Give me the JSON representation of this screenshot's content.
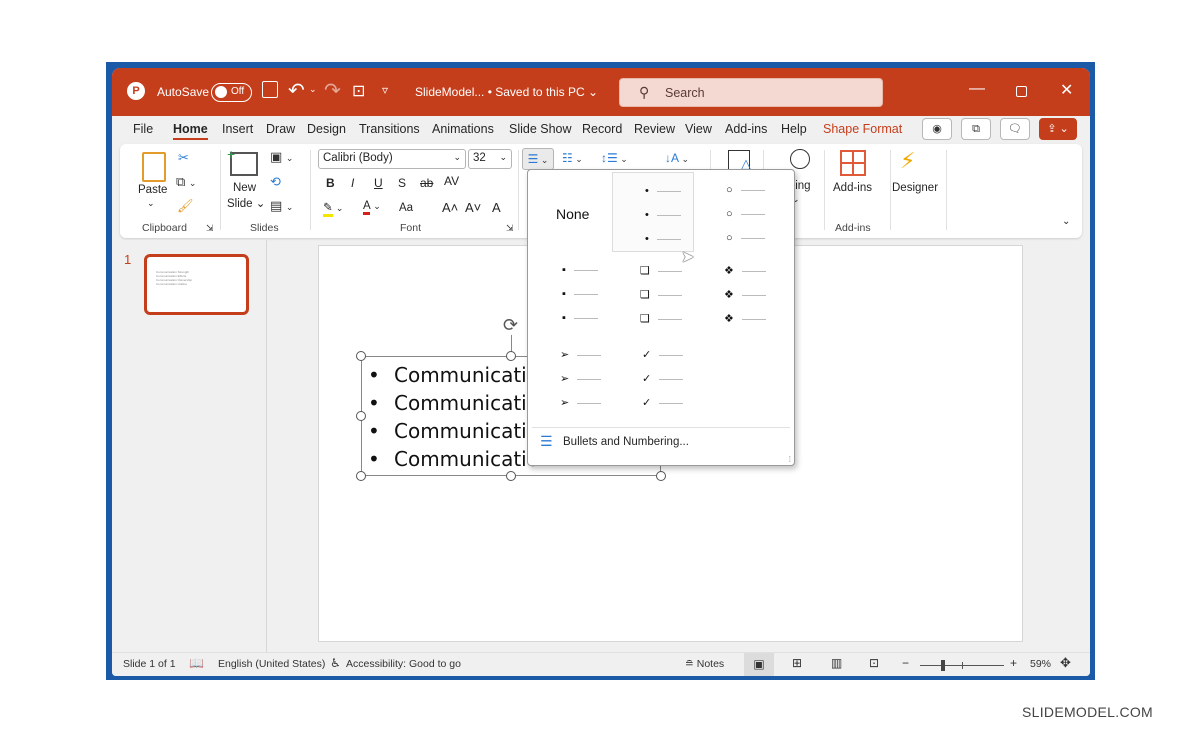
{
  "titlebar": {
    "app_icon": "powerpoint-icon",
    "autosave_label": "AutoSave",
    "autosave_state": "Off",
    "doc_title": "SlideModel... • Saved to this PC",
    "doc_chevron": "⌄",
    "search_placeholder": "Search",
    "icons": {
      "save": "💾",
      "undo": "↶",
      "redo": "↷",
      "present": "⊡",
      "customize": "▿",
      "search": "⚲",
      "minimize": "—",
      "maximize": "☐",
      "close": "✕"
    }
  },
  "tabs": [
    {
      "label": "File"
    },
    {
      "label": "Home",
      "active": true
    },
    {
      "label": "Insert"
    },
    {
      "label": "Draw"
    },
    {
      "label": "Design"
    },
    {
      "label": "Transitions"
    },
    {
      "label": "Animations"
    },
    {
      "label": "Slide Show"
    },
    {
      "label": "Record"
    },
    {
      "label": "Review"
    },
    {
      "label": "View"
    },
    {
      "label": "Add-ins"
    },
    {
      "label": "Help"
    },
    {
      "label": "Shape Format",
      "accent": true
    }
  ],
  "tab_buttons": {
    "record": "◉",
    "teams": "⧉",
    "comments": "🗨",
    "share": "⇪ ⌄"
  },
  "ribbon": {
    "clipboard": {
      "paste": "Paste",
      "group": "Clipboard"
    },
    "slides": {
      "new_slide": "New",
      "new_slide2": "Slide ⌄",
      "group": "Slides"
    },
    "font": {
      "font_name": "Calibri (Body)",
      "font_size": "32",
      "bold": "B",
      "italic": "I",
      "underline": "U",
      "shadow": "S",
      "strike": "ab",
      "spacing": "AV",
      "change_case": "Aa",
      "grow": "A˄",
      "shrink": "A˅",
      "clear": "A",
      "group": "Font"
    },
    "drawing_label": "ting",
    "addins": {
      "label": "Add-ins",
      "group": "Add-ins"
    },
    "designer": {
      "label": "Designer"
    }
  },
  "slide_panel": {
    "slide_number": "1",
    "thumb_lines": [
      "Communication Strength",
      "Communication Efforts",
      "Communication Ownership",
      "Communication Hotline"
    ]
  },
  "slide": {
    "bullets": [
      "Communicatio",
      "Communicatio",
      "Communicatio",
      "Communicatio"
    ],
    "bullet_char": "•"
  },
  "bullet_menu": {
    "none_label": "None",
    "styles": [
      {
        "name": "filled-round",
        "glyph": "•"
      },
      {
        "name": "hollow-round",
        "glyph": "○"
      },
      {
        "name": "filled-square",
        "glyph": "▪"
      },
      {
        "name": "hollow-square",
        "glyph": "❑"
      },
      {
        "name": "star",
        "glyph": "❖"
      },
      {
        "name": "arrow",
        "glyph": "➢"
      },
      {
        "name": "checkmark",
        "glyph": "✓"
      }
    ],
    "footer": "Bullets and Numbering..."
  },
  "status": {
    "slide_of": "Slide 1 of 1",
    "language": "English (United States)",
    "accessibility": "Accessibility: Good to go",
    "notes": "Notes",
    "zoom_minus": "−",
    "zoom_plus": "+",
    "zoom_level": "59%",
    "zoom_fraction": 0.59
  },
  "watermark": "SLIDEMODEL.COM"
}
